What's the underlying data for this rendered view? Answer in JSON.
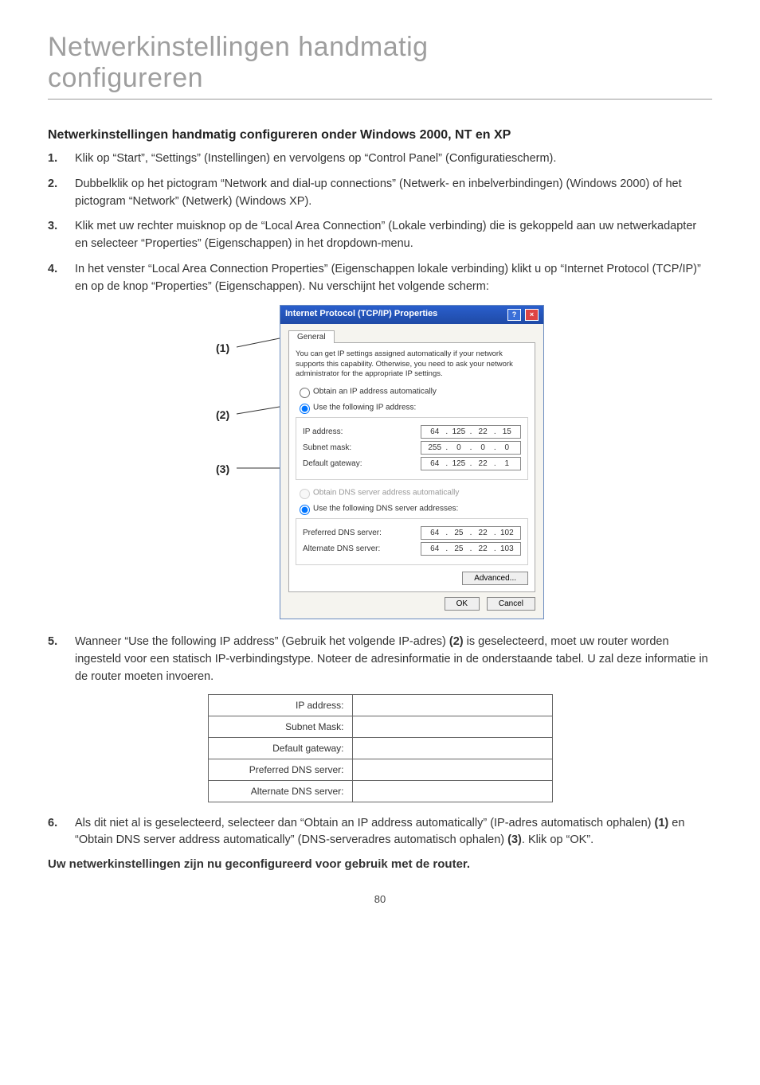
{
  "page": {
    "title_line1": "Netwerkinstellingen handmatig",
    "title_line2": "configureren",
    "number": "80"
  },
  "section": {
    "heading": "Netwerkinstellingen handmatig configureren onder Windows 2000, NT en XP"
  },
  "steps": {
    "s1": {
      "num": "1.",
      "text": "Klik op “Start”, “Settings” (Instellingen) en vervolgens op “Control Panel” (Configuratiescherm)."
    },
    "s2": {
      "num": "2.",
      "text": "Dubbelklik op het pictogram “Network and dial-up connections” (Netwerk- en inbelverbindingen) (Windows 2000) of het pictogram “Network” (Netwerk) (Windows XP)."
    },
    "s3": {
      "num": "3.",
      "text": "Klik met uw rechter muisknop op de “Local Area Connection” (Lokale verbinding) die is gekoppeld aan uw netwerkadapter en selecteer “Properties” (Eigenschappen) in het dropdown-menu."
    },
    "s4": {
      "num": "4.",
      "text": "In het venster “Local Area Connection Properties” (Eigenschappen lokale verbinding) klikt u op “Internet Protocol (TCP/IP)” en op de knop “Properties” (Eigenschappen). Nu verschijnt het volgende scherm:"
    },
    "s5": {
      "num": "5.",
      "pre": "Wanneer “Use the following IP address” (Gebruik het volgende IP-adres) ",
      "ref": "(2)",
      "post": " is geselecteerd, moet uw router worden ingesteld voor een statisch IP-verbindingstype. Noteer de adresinformatie in de onderstaande tabel. U zal deze informatie in de router moeten invoeren."
    },
    "s6": {
      "num": "6.",
      "pre": "Als dit niet al is geselecteerd, selecteer dan “Obtain an IP address automatically” (IP-adres automatisch ophalen) ",
      "ref1": "(1)",
      "mid": " en “Obtain DNS server address automatically” (DNS-serveradres automatisch ophalen) ",
      "ref2": "(3)",
      "post": ". Klik op “OK”."
    }
  },
  "callouts": {
    "c1": "(1)",
    "c2": "(2)",
    "c3": "(3)"
  },
  "dialog": {
    "title": "Internet Protocol (TCP/IP) Properties",
    "help_icon": "?",
    "close_icon": "×",
    "tab": "General",
    "desc": "You can get IP settings assigned automatically if your network supports this capability. Otherwise, you need to ask your network administrator for the appropriate IP settings.",
    "radio_auto_ip": "Obtain an IP address automatically",
    "radio_use_ip": "Use the following IP address:",
    "lbl_ip": "IP address:",
    "lbl_mask": "Subnet mask:",
    "lbl_gw": "Default gateway:",
    "ip": {
      "a": "64",
      "b": "125",
      "c": "22",
      "d": "15"
    },
    "mask": {
      "a": "255",
      "b": "0",
      "c": "0",
      "d": "0"
    },
    "gw": {
      "a": "64",
      "b": "125",
      "c": "22",
      "d": "1"
    },
    "radio_auto_dns": "Obtain DNS server address automatically",
    "radio_use_dns": "Use the following DNS server addresses:",
    "lbl_pref": "Preferred DNS server:",
    "lbl_alt": "Alternate DNS server:",
    "pref": {
      "a": "64",
      "b": "25",
      "c": "22",
      "d": "102"
    },
    "alt": {
      "a": "64",
      "b": "25",
      "c": "22",
      "d": "103"
    },
    "btn_adv": "Advanced...",
    "btn_ok": "OK",
    "btn_cancel": "Cancel"
  },
  "table": {
    "ip": "IP address:",
    "mask": "Subnet Mask:",
    "gw": "Default gateway:",
    "pref": "Preferred DNS server:",
    "alt": "Alternate DNS server:"
  },
  "final": "Uw netwerkinstellingen zijn nu geconfigureerd voor gebruik met de router."
}
